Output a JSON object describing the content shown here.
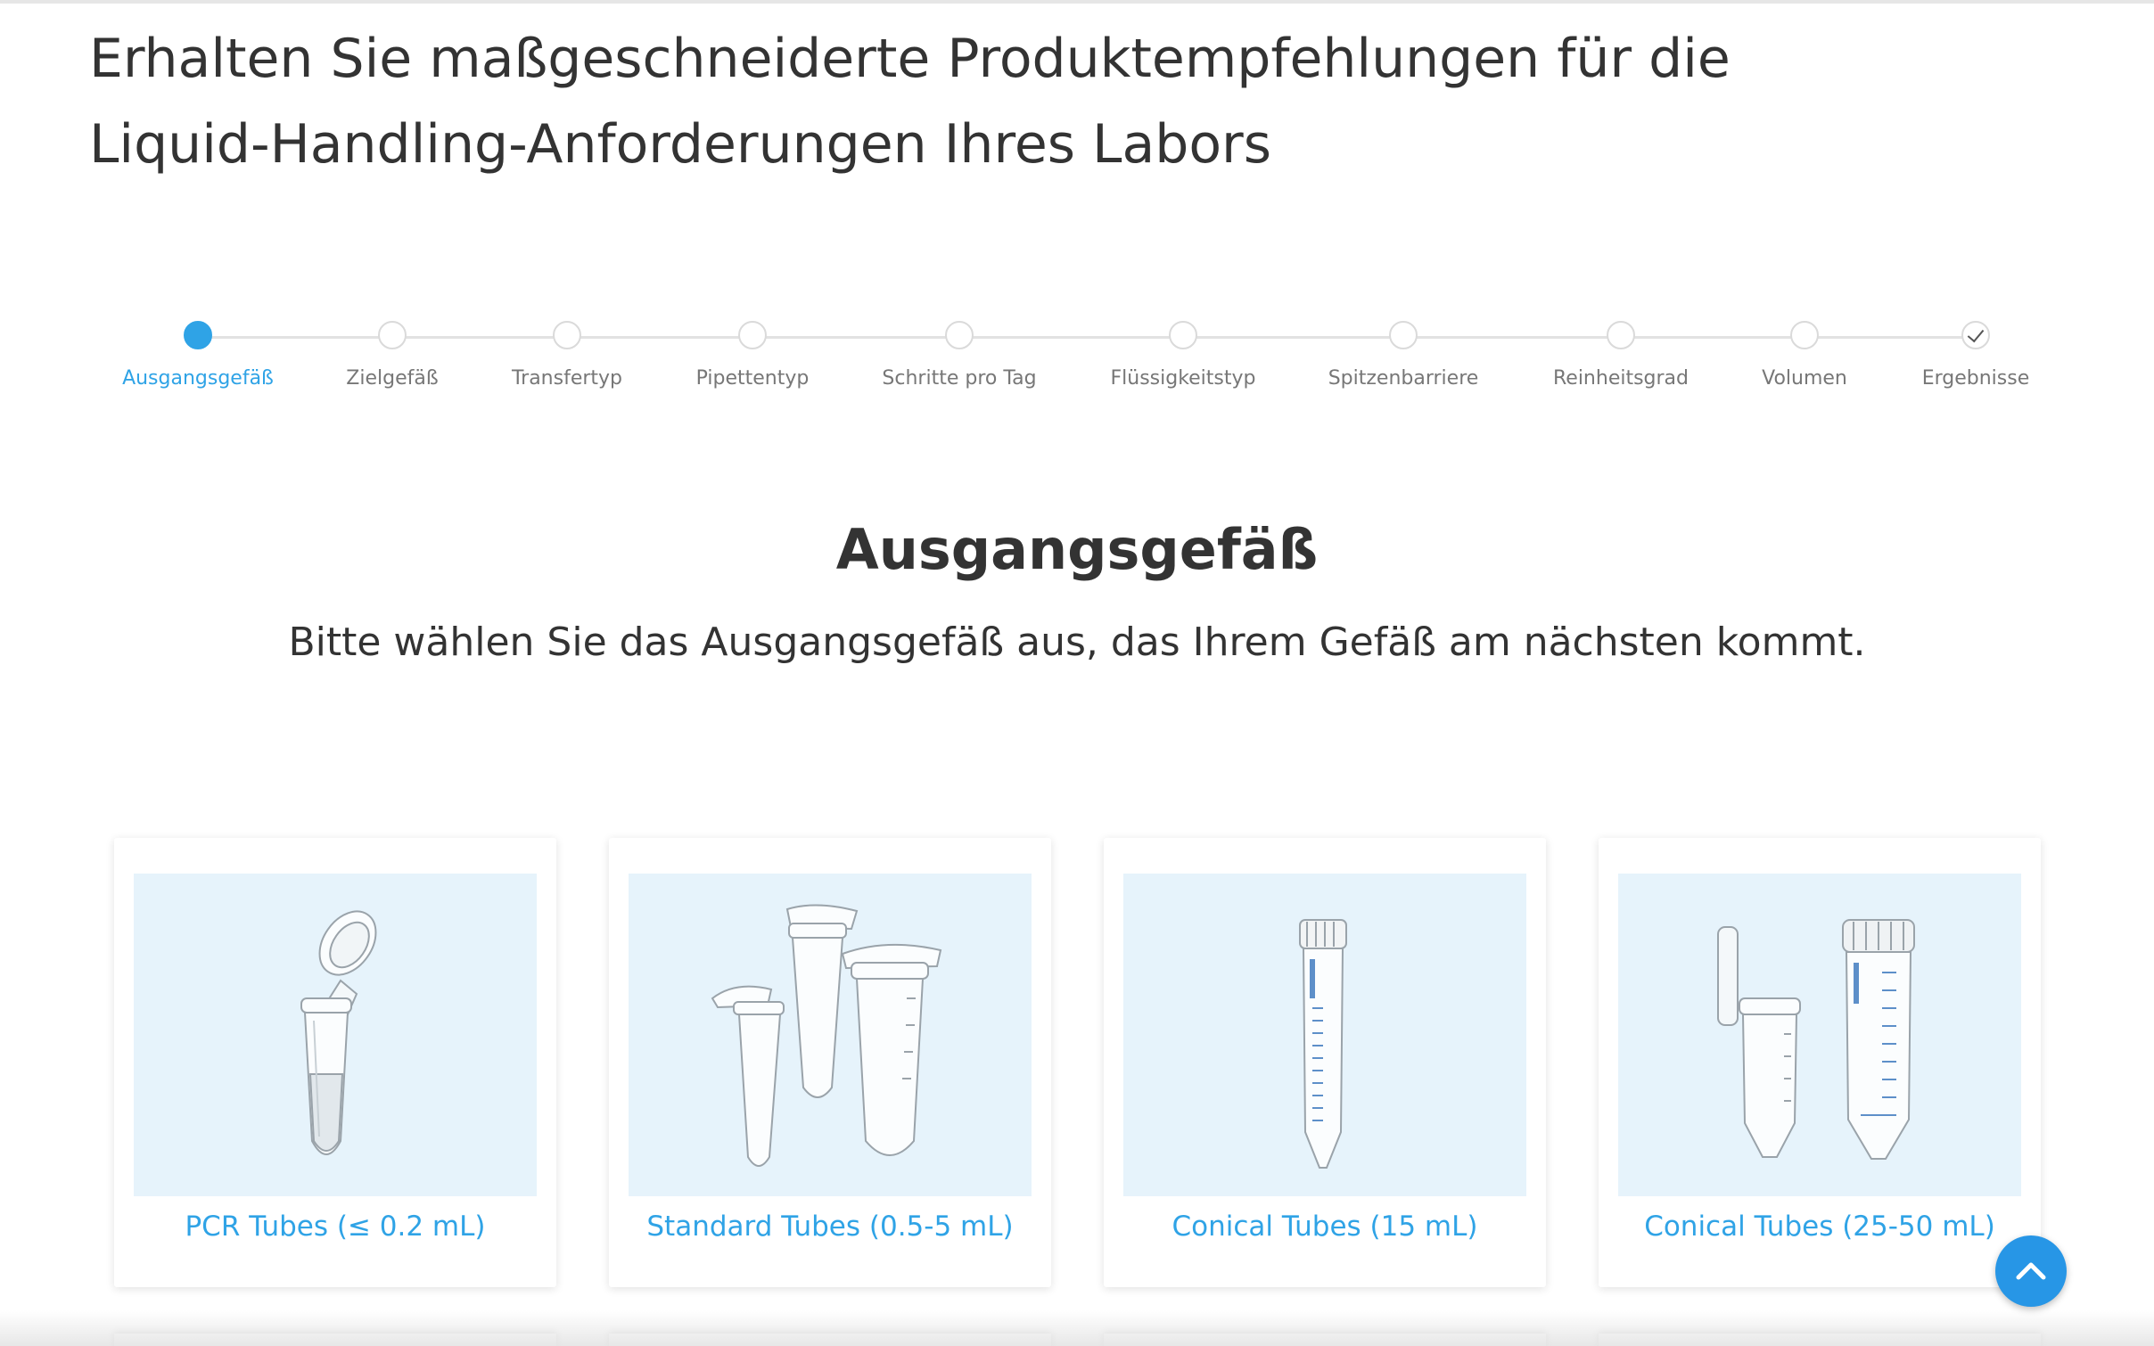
{
  "header": {
    "headline_line1": "Erhalten Sie maßgeschneiderte Produktempfehlungen für die",
    "headline_line2": "Liquid-Handling-Anforderungen Ihres Labors"
  },
  "stepper": {
    "active_index": 0,
    "steps": [
      {
        "label": "Ausgangsgefäß"
      },
      {
        "label": "Zielgefäß"
      },
      {
        "label": "Transfertyp"
      },
      {
        "label": "Pipettentyp"
      },
      {
        "label": "Schritte pro Tag"
      },
      {
        "label": "Flüssigkeitstyp"
      },
      {
        "label": "Spitzenbarriere"
      },
      {
        "label": "Reinheitsgrad"
      },
      {
        "label": "Volumen"
      },
      {
        "label": "Ergebnisse"
      }
    ]
  },
  "section": {
    "title": "Ausgangsgefäß",
    "subtitle": "Bitte wählen Sie das Ausgangsgefäß aus, das Ihrem Gefäß am nächsten kommt."
  },
  "options": [
    {
      "label": "PCR Tubes (≤ 0.2 mL)",
      "image": "pcr-tube-image"
    },
    {
      "label": "Standard Tubes (0.5-5 mL)",
      "image": "standard-tubes-image"
    },
    {
      "label": "Conical Tubes (15 mL)",
      "image": "conical-tube-15-image"
    },
    {
      "label": "Conical Tubes (25-50 mL)",
      "image": "conical-tubes-25-50-image"
    }
  ],
  "tube_branding": "eppendorf",
  "colors": {
    "accent": "#2fa3e6",
    "card_image_bg": "#e6f3fb",
    "scroll_button": "#2796e6",
    "text": "#333333",
    "muted": "#777777"
  },
  "scroll_top_icon": "chevron-up-icon"
}
